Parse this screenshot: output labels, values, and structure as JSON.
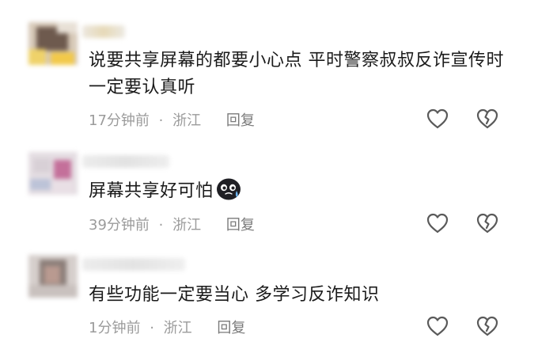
{
  "comments": [
    {
      "text": "说要共享屏幕的都要小心点  平时警察叔叔反诈宣传时一定要认真听",
      "time": "17分钟前",
      "dot": "·",
      "location": "浙江",
      "reply_label": "回复"
    },
    {
      "text": "屏幕共享好可怕",
      "emoji": "crying-emoji",
      "time": "39分钟前",
      "dot": "·",
      "location": "浙江",
      "reply_label": "回复"
    },
    {
      "text": "有些功能一定要当心 多学习反诈知识",
      "time": "1分钟前",
      "dot": "·",
      "location": "浙江",
      "reply_label": "回复"
    }
  ],
  "icons": {
    "like": "heart-outline-icon",
    "dislike": "broken-heart-outline-icon"
  },
  "colors": {
    "text": "#1a1a1a",
    "meta": "#9b9b9b",
    "icon": "#5a5a5a"
  }
}
